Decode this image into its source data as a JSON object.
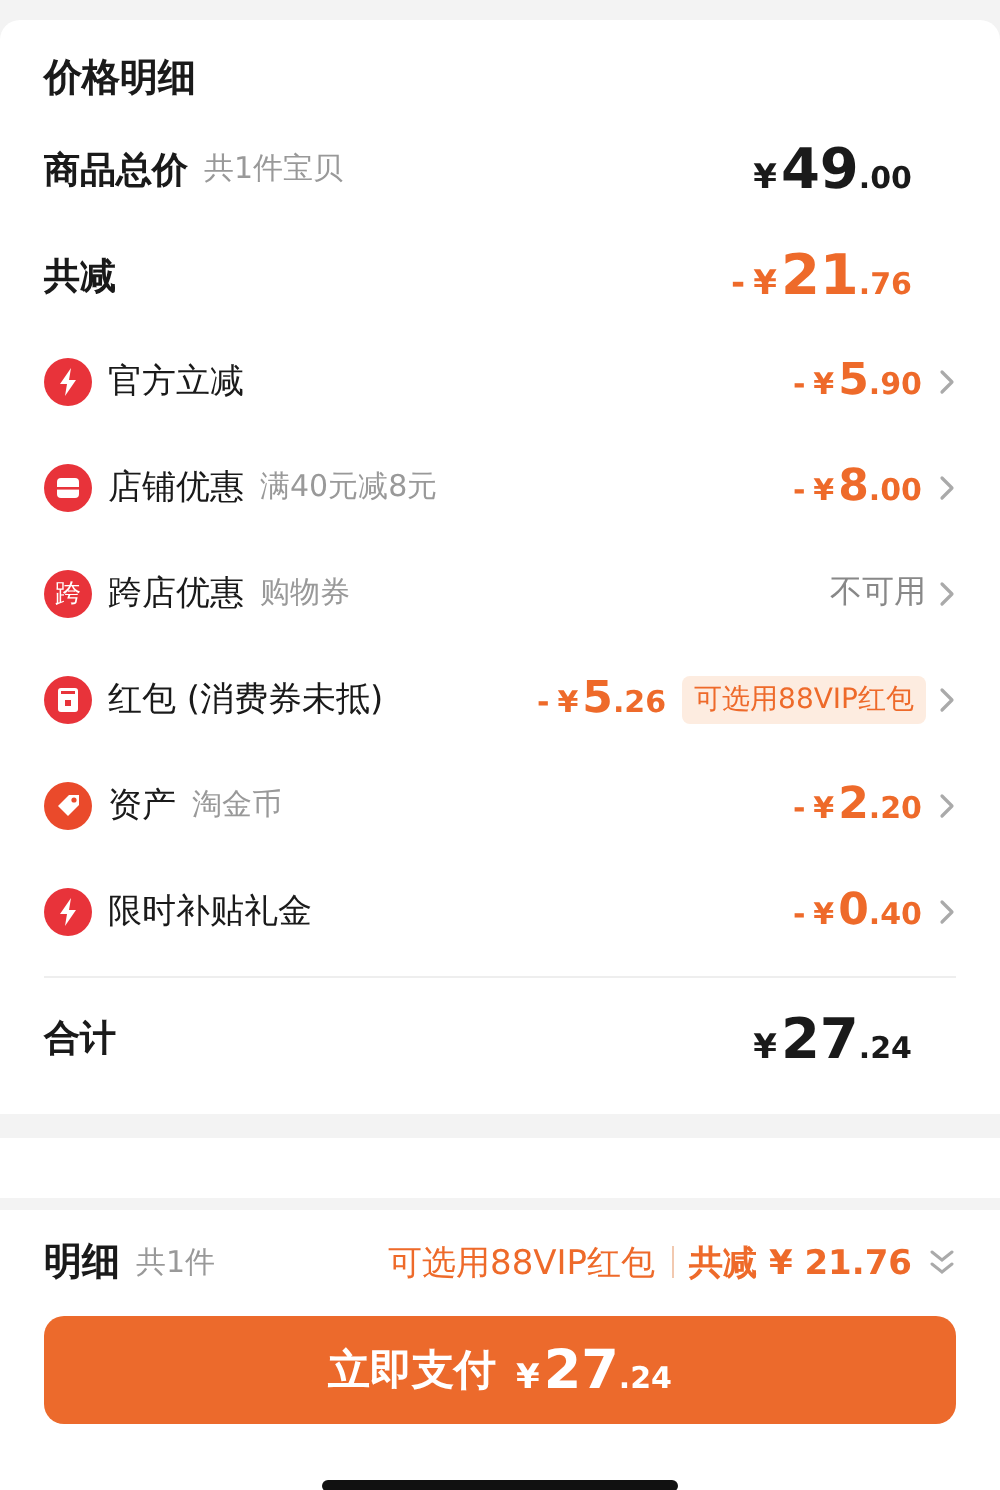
{
  "title": "价格明细",
  "summary": [
    {
      "kind": "total",
      "label": "商品总价",
      "note": "共1件宝贝",
      "amount": {
        "currency": "¥",
        "integer": "49",
        "fraction": ".00"
      }
    },
    {
      "kind": "discount",
      "label": "共减",
      "amount": {
        "sign": "-",
        "currency": "¥",
        "integer": "21",
        "fraction": ".76"
      }
    }
  ],
  "discounts": [
    {
      "kind": "bolt",
      "label": "官方立减",
      "amount": {
        "sign": "-",
        "currency": "¥",
        "integer": "5",
        "fraction": ".90"
      }
    },
    {
      "kind": "store",
      "label": "店铺优惠",
      "note": "满40元减8元",
      "amount": {
        "sign": "-",
        "currency": "¥",
        "integer": "8",
        "fraction": ".00"
      }
    },
    {
      "kind": "char",
      "icon_text": "跨",
      "label": "跨店优惠",
      "note": "购物券",
      "status": "不可用"
    },
    {
      "kind": "packet",
      "label": "红包 (消费券未抵)",
      "amount": {
        "sign": "-",
        "currency": "¥",
        "integer": "5",
        "fraction": ".26"
      },
      "badge": "可选用88VIP红包"
    },
    {
      "kind": "tag",
      "label": "资产",
      "note": "淘金币",
      "amount": {
        "sign": "-",
        "currency": "¥",
        "integer": "2",
        "fraction": ".20"
      }
    },
    {
      "kind": "bolt",
      "label": "限时补贴礼金",
      "amount": {
        "sign": "-",
        "currency": "¥",
        "integer": "0",
        "fraction": ".40"
      }
    }
  ],
  "total": {
    "label": "合计",
    "amount": {
      "currency": "¥",
      "integer": "27",
      "fraction": ".24"
    }
  },
  "bottom_bar": {
    "label": "明细",
    "count": "共1件",
    "hint": "可选用88VIP红包",
    "saving": "共减 ¥ 21.76"
  },
  "pay_button": {
    "label": "立即支付",
    "amount": {
      "currency": "¥",
      "integer": "27",
      "fraction": ".24"
    }
  }
}
